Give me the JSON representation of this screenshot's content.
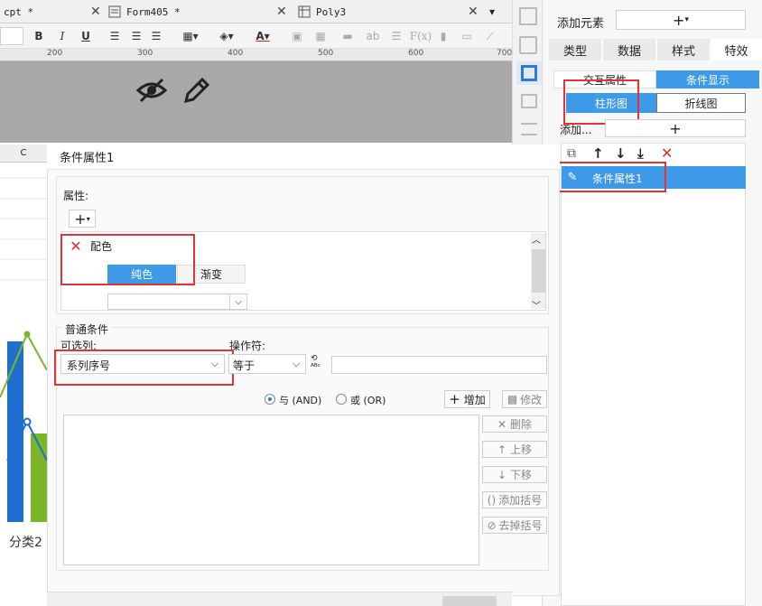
{
  "tabs": [
    {
      "label": "cpt *"
    },
    {
      "label": "Form405 *"
    },
    {
      "label": "Poly3"
    }
  ],
  "ruler": {
    "ticks": [
      "200",
      "300",
      "400",
      "500",
      "600",
      "700"
    ]
  },
  "toolbar": {
    "bold": "B",
    "italic": "I",
    "underline": "U"
  },
  "right_panel": {
    "add_element_label": "添加元素",
    "tabs": [
      "类型",
      "数据",
      "样式",
      "特效"
    ],
    "subtabs": [
      "交互属性",
      "条件显示"
    ],
    "chart_tabs": [
      "柱形图",
      "折线图"
    ],
    "add_label": "添加...",
    "list_item": "条件属性1"
  },
  "sheet": {
    "col_header": "C",
    "category_label": "分类2"
  },
  "dialog": {
    "title": "条件属性1",
    "property_label": "属性:",
    "color_label": "配色",
    "solid_label": "纯色",
    "gradient_label": "渐变",
    "normal_condition_label": "普通条件",
    "optional_col_label": "可选列:",
    "operator_label": "操作符:",
    "column_value": "系列序号",
    "operator_value": "等于",
    "and_label": "与 (AND)",
    "or_label": "或 (OR)",
    "add_button": "增加",
    "modify_button": "修改",
    "delete_button": "删除",
    "move_up_button": "上移",
    "move_down_button": "下移",
    "add_bracket_button": "添加括号",
    "remove_bracket_button": "去掉括号"
  },
  "colors": {
    "accent": "#3d9ae8",
    "highlight": "#e03535",
    "bar_blue": "#1f6fcf",
    "bar_green": "#7bb52a"
  }
}
